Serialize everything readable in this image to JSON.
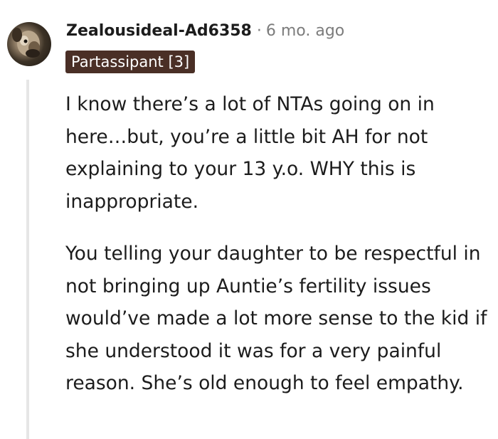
{
  "comment": {
    "username": "Zealousideal-Ad6358",
    "separator": "·",
    "timestamp": "6 mo. ago",
    "flair": "Partassipant [3]",
    "paragraphs": [
      "I know there’s a lot of NTAs going on in here…but, you’re a little bit AH for not explaining to your 13 y.o. WHY this is inappropriate.",
      "You telling your daughter to be respectful in not bringing up Auntie’s fertility issues would’ve made a lot more sense to the kid if she understood it was for a very painful reason. She’s old enough to feel empathy."
    ]
  },
  "colors": {
    "flair_background": "#4a2f26",
    "flair_text": "#ffffff",
    "meta_text": "#7c7c7c",
    "thread_line": "#e6e6e6"
  }
}
